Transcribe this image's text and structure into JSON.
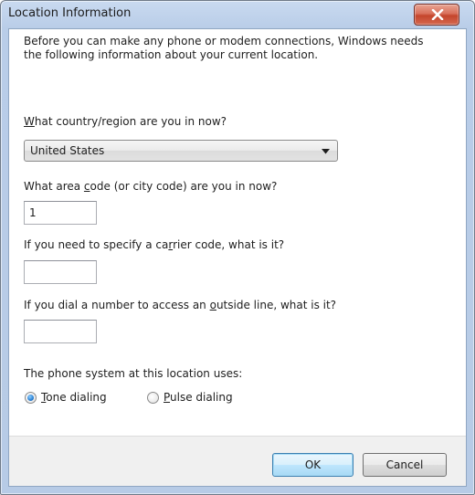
{
  "window": {
    "title": "Location Information"
  },
  "description": {
    "line1": "Before you can make any phone or modem connections, Windows needs",
    "line2": "the following information about your current location."
  },
  "country": {
    "label_pre": "",
    "label_key": "W",
    "label_post": "hat country/region are you in now?",
    "selected": "United States"
  },
  "area_code": {
    "label_pre": "What area ",
    "label_key": "c",
    "label_post": "ode (or city code) are you in now?",
    "value": "1"
  },
  "carrier_code": {
    "label_pre": "If you need to specify a ca",
    "label_key": "r",
    "label_post": "rier code, what is it?",
    "value": ""
  },
  "outside_line": {
    "label_pre": "If you dial a number to access an ",
    "label_key": "o",
    "label_post": "utside line, what is it?",
    "value": ""
  },
  "phone_system": {
    "label": "The phone system at this location uses:",
    "tone": {
      "label_key": "T",
      "label_post": "one dialing",
      "checked": true
    },
    "pulse": {
      "label_key": "P",
      "label_post": "ulse dialing",
      "checked": false
    }
  },
  "buttons": {
    "ok": "OK",
    "cancel": "Cancel"
  },
  "icons": {
    "close": "close-icon",
    "dropdown": "chevron-down-icon"
  },
  "colors": {
    "close_button": "#c4452c",
    "default_button_border": "#3c7fb1",
    "radio_selected": "#2a7fd3"
  }
}
